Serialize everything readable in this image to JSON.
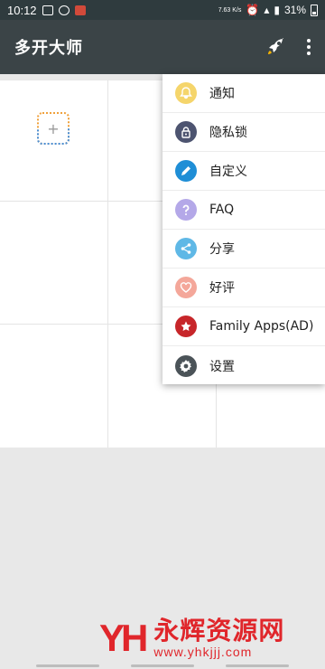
{
  "status": {
    "time": "10:12",
    "net_speed": "7.63 K/s",
    "battery": "31%"
  },
  "app": {
    "title": "多开大师"
  },
  "menu": {
    "items": [
      {
        "label": "通知",
        "icon": "bell-icon",
        "color": "#f5d56b"
      },
      {
        "label": "隐私锁",
        "icon": "lock-icon",
        "color": "#4d5470"
      },
      {
        "label": "自定义",
        "icon": "pencil-icon",
        "color": "#1f8ed6"
      },
      {
        "label": "FAQ",
        "icon": "question-icon",
        "color": "#b4a8e8"
      },
      {
        "label": "分享",
        "icon": "share-icon",
        "color": "#5fb8e6"
      },
      {
        "label": "好评",
        "icon": "heart-icon",
        "color": "#f4a79a"
      },
      {
        "label": "Family Apps(AD)",
        "icon": "star-icon",
        "color": "#c7262a"
      },
      {
        "label": "设置",
        "icon": "gear-icon",
        "color": "#4b5358"
      }
    ]
  },
  "grid": {
    "add_label": "+"
  },
  "watermark": {
    "logo": "YH",
    "name": "永辉资源网",
    "url": "www.yhkjjj.com"
  }
}
